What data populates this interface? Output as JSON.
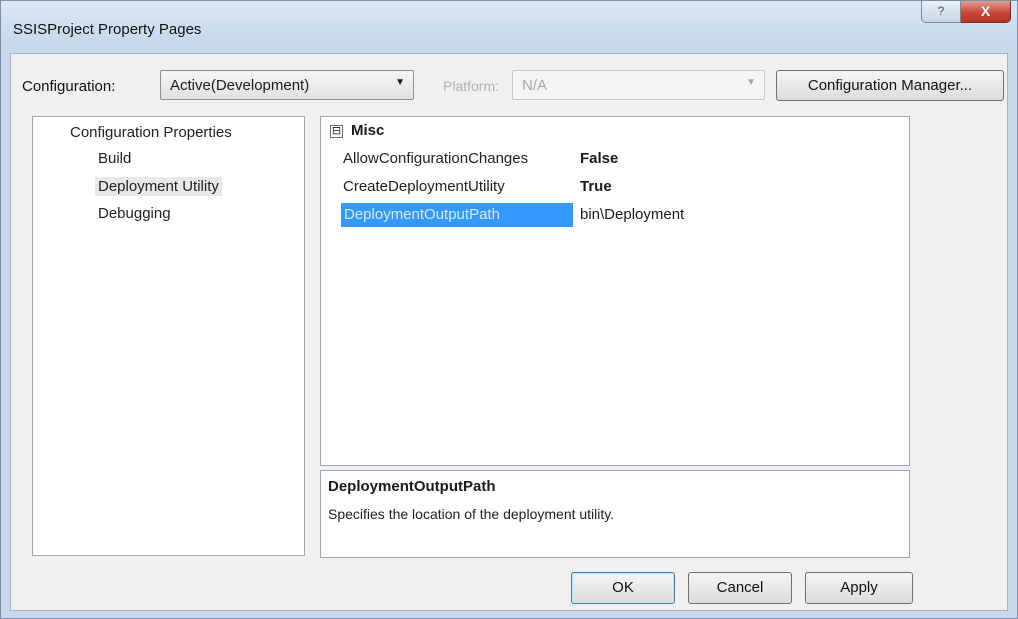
{
  "window": {
    "title": "SSISProject Property Pages",
    "help_label": "?",
    "close_label": "X"
  },
  "toolbar": {
    "configuration_label": "Configuration:",
    "configuration_value": "Active(Development)",
    "platform_label": "Platform:",
    "platform_value": "N/A",
    "configuration_manager_label": "Configuration Manager..."
  },
  "tree": {
    "items": [
      {
        "label": "Configuration Properties"
      },
      {
        "label": "Build"
      },
      {
        "label": "Deployment Utility"
      },
      {
        "label": "Debugging"
      }
    ],
    "selected": "Deployment Utility"
  },
  "grid": {
    "category": "Misc",
    "collapse_glyph": "⊟",
    "properties": [
      {
        "name": "AllowConfigurationChanges",
        "value": "False"
      },
      {
        "name": "CreateDeploymentUtility",
        "value": "True"
      },
      {
        "name": "DeploymentOutputPath",
        "value": "bin\\Deployment"
      }
    ],
    "selected": "DeploymentOutputPath"
  },
  "description": {
    "title": "DeploymentOutputPath",
    "text": "Specifies the location of the deployment utility."
  },
  "buttons": {
    "ok_label": "OK",
    "cancel_label": "Cancel",
    "apply_label": "Apply"
  },
  "colors": {
    "selection": "#3399ff",
    "frame": "#c9d9ea",
    "close_button": "#c9473a"
  }
}
